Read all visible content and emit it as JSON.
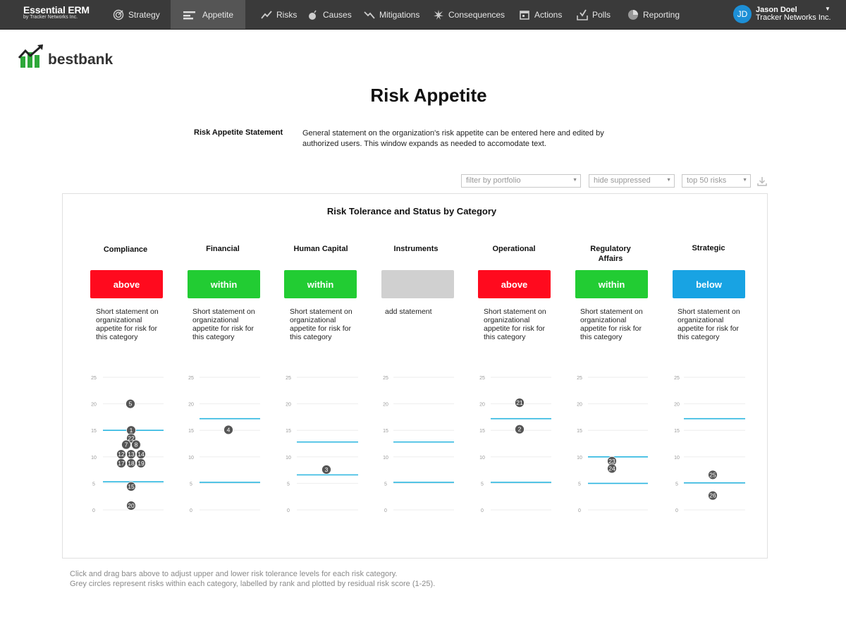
{
  "app": {
    "name": "Essential ERM",
    "subtitle": "by Tracker Networks Inc."
  },
  "nav": [
    {
      "label": "Strategy",
      "icon": "target-icon",
      "active": false
    },
    {
      "label": "Appetite",
      "icon": "sliders-icon",
      "active": true
    },
    {
      "label": "Risks",
      "icon": "trend-up-icon",
      "active": false
    },
    {
      "label": "Causes",
      "icon": "bomb-icon",
      "active": false
    },
    {
      "label": "Mitigations",
      "icon": "trend-down-icon",
      "active": false
    },
    {
      "label": "Consequences",
      "icon": "burst-icon",
      "active": false
    },
    {
      "label": "Actions",
      "icon": "calendar-icon",
      "active": false
    },
    {
      "label": "Polls",
      "icon": "ballot-icon",
      "active": false
    },
    {
      "label": "Reporting",
      "icon": "pie-chart-icon",
      "active": false
    }
  ],
  "user": {
    "initials": "JD",
    "name": "Jason Doel",
    "org": "Tracker Networks Inc."
  },
  "logo": {
    "text": "bestbank"
  },
  "page": {
    "title": "Risk Appetite",
    "statement_label": "Risk Appetite Statement",
    "statement_text": "General statement on the organization's risk appetite can be entered here and edited by authorized users.  This window expands as needed to accomodate text."
  },
  "filters": {
    "portfolio": "filter by portfolio",
    "suppressed": "hide suppressed",
    "top": "top 50 risks"
  },
  "panel": {
    "title": "Risk Tolerance and Status by Category"
  },
  "colors": {
    "above": "#ff0a1e",
    "within": "#22cc33",
    "below": "#18a3e3",
    "none": "#d0d0d0",
    "tolerance_line": "#2bb6e0",
    "dot": "#555555"
  },
  "y_ticks": [
    "25",
    "20",
    "15",
    "10",
    "5",
    "0"
  ],
  "categories": [
    {
      "title": "Compliance",
      "status": "above",
      "status_key": "above",
      "statement": "Short statement on organizational appetite for risk for this category",
      "upper": 15,
      "lower": 5.3,
      "risks": [
        {
          "rank": "5",
          "score": 20
        },
        {
          "rank": "1",
          "score": 15
        },
        {
          "rank": "22",
          "score": 13.5
        },
        {
          "rank": "7",
          "score": 12.3
        },
        {
          "rank": "8",
          "score": 12.3
        },
        {
          "rank": "12",
          "score": 10.5
        },
        {
          "rank": "13",
          "score": 10.5
        },
        {
          "rank": "14",
          "score": 10.5
        },
        {
          "rank": "17",
          "score": 8.8
        },
        {
          "rank": "18",
          "score": 8.8
        },
        {
          "rank": "19",
          "score": 8.8
        },
        {
          "rank": "15",
          "score": 4.4
        },
        {
          "rank": "20",
          "score": 0.8
        }
      ]
    },
    {
      "title": "Financial",
      "status": "within",
      "status_key": "within",
      "statement": "Short statement on organizational appetite for risk for this category",
      "upper": 17.2,
      "lower": 5.2,
      "risks": [
        {
          "rank": "4",
          "score": 15.1
        }
      ]
    },
    {
      "title": "Human Capital",
      "status": "within",
      "status_key": "within",
      "statement": "Short statement on organizational appetite for risk for this category",
      "upper": 12.8,
      "lower": 6.6,
      "risks": [
        {
          "rank": "3",
          "score": 7.6
        }
      ]
    },
    {
      "title": "Instruments",
      "status": "",
      "status_key": "none",
      "statement": "add statement",
      "upper": 12.8,
      "lower": 5.2,
      "risks": []
    },
    {
      "title": "Operational",
      "status": "above",
      "status_key": "above",
      "statement": "Short statement on organizational appetite for risk for this category",
      "upper": 17.2,
      "lower": 5.2,
      "risks": [
        {
          "rank": "21",
          "score": 20.2
        },
        {
          "rank": "2",
          "score": 15.2
        }
      ]
    },
    {
      "title": "Regulatory Affairs",
      "status": "within",
      "status_key": "within",
      "statement": "Short statement on organizational appetite for risk for this category",
      "upper": 10,
      "lower": 5,
      "risks": [
        {
          "rank": "23",
          "score": 9.2
        },
        {
          "rank": "24",
          "score": 7.8
        }
      ]
    },
    {
      "title": "Strategic",
      "status": "below",
      "status_key": "below",
      "statement": "Short statement on organizational appetite for risk for this category",
      "upper": 17.2,
      "lower": 5.1,
      "risks": [
        {
          "rank": "25",
          "score": 6.6
        },
        {
          "rank": "26",
          "score": 2.7
        }
      ]
    }
  ],
  "footnote": [
    "Click and drag bars above to adjust upper and lower risk tolerance levels for each risk category.",
    "Grey circles represent risks within each category, labelled by rank and plotted by residual risk score (1-25)."
  ]
}
